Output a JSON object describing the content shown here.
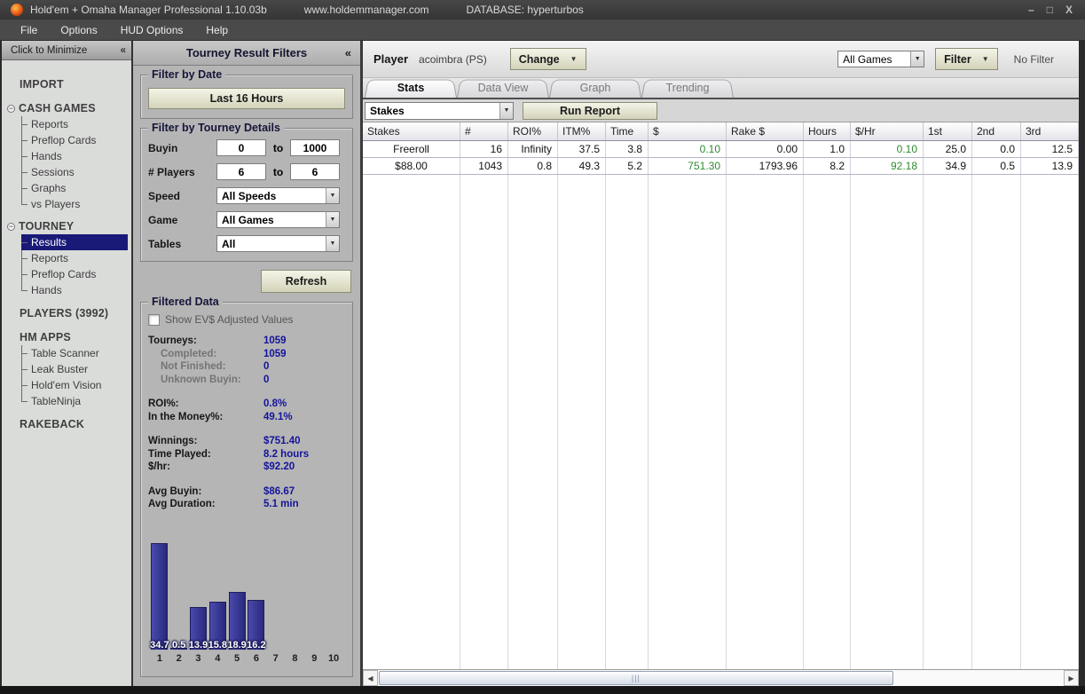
{
  "colors": {
    "accent_navy": "#191977",
    "value_navy": "#14149b",
    "money_green": "#2f8a2f",
    "bar_navy": "#31319a"
  },
  "titlebar": {
    "app_title": "Hold'em + Omaha Manager Professional 1.10.03b",
    "website": "www.holdemmanager.com",
    "database": "DATABASE: hyperturbos",
    "minimize": "–",
    "maximize": "□",
    "close": "X"
  },
  "menubar": {
    "items": [
      "File",
      "Options",
      "HUD Options",
      "Help"
    ]
  },
  "sidebar": {
    "minimize_label": "Click to Minimize",
    "collapse_chevron": "«",
    "import_label": "IMPORT",
    "cash_games": {
      "label": "CASH GAMES",
      "items": [
        "Reports",
        "Preflop Cards",
        "Hands",
        "Sessions",
        "Graphs",
        "vs Players"
      ]
    },
    "tourney": {
      "label": "TOURNEY",
      "items": [
        "Results",
        "Reports",
        "Preflop Cards",
        "Hands"
      ],
      "selected_item": "Results"
    },
    "players_label": "PLAYERS (3992)",
    "hm_apps": {
      "label": "HM APPS",
      "items": [
        "Table Scanner",
        "Leak Buster",
        "Hold'em Vision",
        "TableNinja"
      ]
    },
    "rakeback_label": "RAKEBACK"
  },
  "filters": {
    "title": "Tourney Result Filters",
    "collapse_chevron": "«",
    "date": {
      "legend": "Filter by Date",
      "range_button": "Last 16 Hours"
    },
    "details": {
      "legend": "Filter by Tourney Details",
      "buyin_label": "Buyin",
      "to_label": "to",
      "buyin_from": "0",
      "buyin_to": "1000",
      "players_label": "# Players",
      "players_from": "6",
      "players_to": "6",
      "speed_label": "Speed",
      "speed_value": "All Speeds",
      "game_label": "Game",
      "game_value": "All Games",
      "tables_label": "Tables",
      "tables_value": "All"
    },
    "refresh_button": "Refresh",
    "filtered": {
      "legend": "Filtered Data",
      "ev_checkbox_label": "Show EV$ Adjusted Values",
      "stats": [
        {
          "label": "Tourneys:",
          "value": "1059"
        },
        {
          "label": "Completed:",
          "value": "1059"
        },
        {
          "label": "Not Finished:",
          "value": "0"
        },
        {
          "label": "Unknown Buyin:",
          "value": "0"
        },
        {
          "label": "ROI%:",
          "value": "0.8%"
        },
        {
          "label": "In the Money%:",
          "value": "49.1%"
        },
        {
          "label": "Winnings:",
          "value": "$751.40"
        },
        {
          "label": "Time Played:",
          "value": "8.2 hours"
        },
        {
          "label": "$/hr:",
          "value": "$92.20"
        },
        {
          "label": "Avg Buyin:",
          "value": "$86.67"
        },
        {
          "label": "Avg Duration:",
          "value": "5.1 min"
        }
      ]
    }
  },
  "main": {
    "player_label": "Player",
    "player_name": "acoimbra (PS)",
    "change_button": "Change",
    "games_select_value": "All Games",
    "filter_button": "Filter",
    "filter_status": "No Filter",
    "tabs": [
      "Stats",
      "Data View",
      "Graph",
      "Trending"
    ],
    "active_tab": "Stats",
    "report_select_value": "Stakes",
    "run_report_button": "Run Report",
    "table": {
      "columns": [
        "Stakes",
        "#",
        "ROI%",
        "ITM%",
        "Time",
        "$",
        "Rake $",
        "Hours",
        "$/Hr",
        "1st",
        "2nd",
        "3rd"
      ],
      "rows": [
        [
          "Freeroll",
          "16",
          "Infinity",
          "37.5",
          "3.8",
          "0.10",
          "0.00",
          "1.0",
          "0.10",
          "25.0",
          "0.0",
          "12.5"
        ],
        [
          "$88.00",
          "1043",
          "0.8",
          "49.3",
          "5.2",
          "751.30",
          "1793.96",
          "8.2",
          "92.18",
          "34.9",
          "0.5",
          "13.9"
        ]
      ]
    }
  },
  "chart_data": {
    "type": "bar",
    "categories": [
      "1",
      "2",
      "3",
      "4",
      "5",
      "6",
      "7",
      "8",
      "9",
      "10"
    ],
    "values": [
      34.7,
      0.5,
      13.9,
      15.8,
      18.9,
      16.2,
      0,
      0,
      0,
      0
    ],
    "bar_labels": [
      "34.7",
      "0.5",
      "13.9",
      "15.8",
      "18.9",
      "16.2",
      "",
      "",
      "",
      ""
    ],
    "title": "",
    "xlabel": "",
    "ylabel": "",
    "ylim": [
      0,
      36
    ],
    "grid": false,
    "legend": false
  }
}
